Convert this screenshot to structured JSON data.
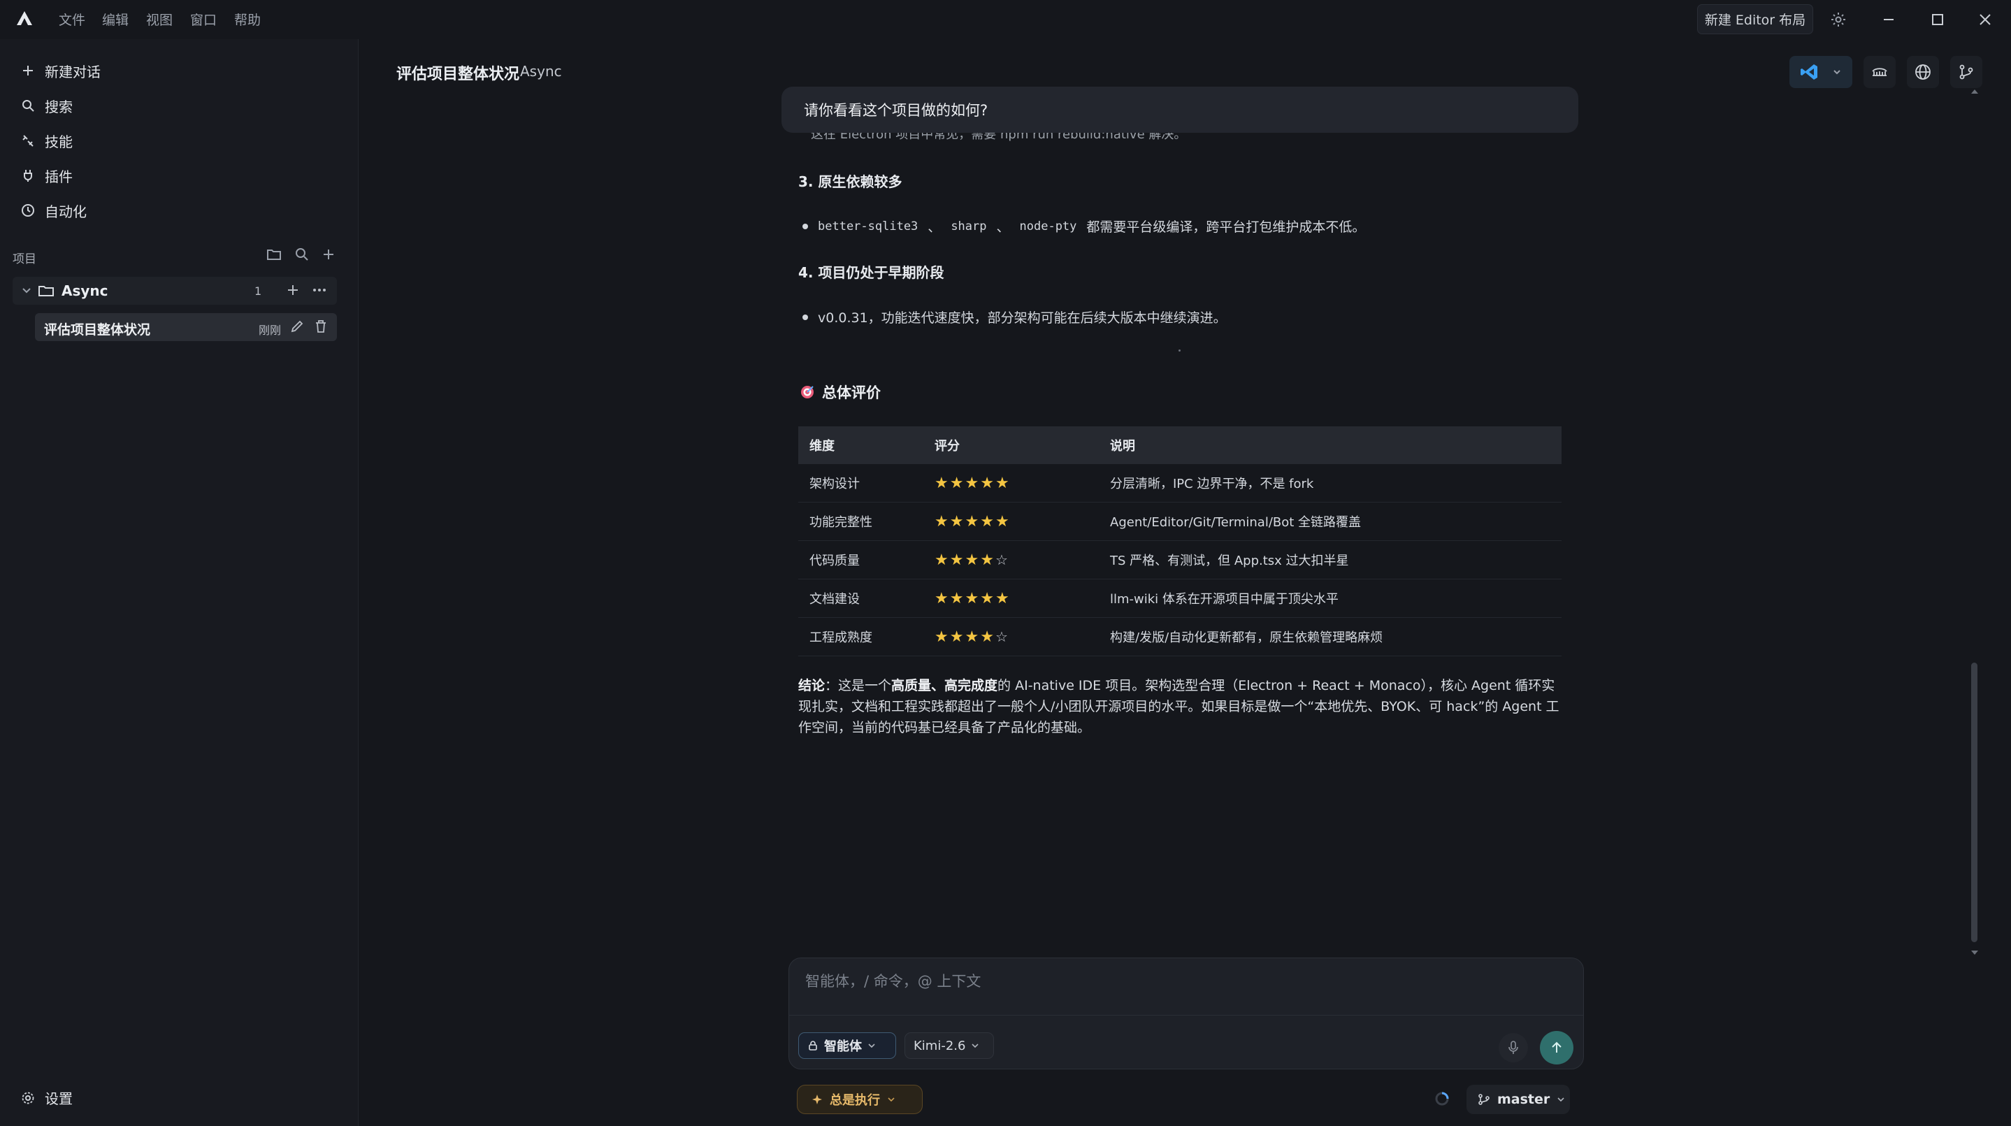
{
  "menu": [
    "文件",
    "编辑",
    "视图",
    "窗口",
    "帮助"
  ],
  "topbar": {
    "layout_button": "新建 Editor 布局"
  },
  "sidebar": {
    "nav": [
      {
        "label": "新建对话",
        "icon": "plus-icon"
      },
      {
        "label": "搜索",
        "icon": "search-icon"
      },
      {
        "label": "技能",
        "icon": "skills-icon"
      },
      {
        "label": "插件",
        "icon": "plugin-icon"
      },
      {
        "label": "自动化",
        "icon": "clock-icon"
      }
    ],
    "section_label": "项目",
    "project": {
      "name": "Async",
      "count": "1"
    },
    "chat": {
      "title": "评估项目整体状况",
      "time": "刚刚"
    },
    "settings_label": "设置"
  },
  "header": {
    "title": "评估项目整体状况",
    "subtitle": "Async"
  },
  "user_message": "请你看看这个项目做的如何?",
  "content": {
    "cutoff_text": "这在 Electron 项目中常见，需要 npm run rebuild:native 解决。",
    "h3": "3. 原生依赖较多",
    "bullet3": {
      "code1": "better-sqlite3",
      "sep1": "、",
      "code2": "sharp",
      "sep2": "、",
      "code3": "node-pty",
      "text": "都需要平台级编译，跨平台打包维护成本不低。"
    },
    "h4": "4. 项目仍处于早期阶段",
    "bullet4": "v0.0.31，功能迭代速度快，部分架构可能在后续大版本中继续演进。",
    "eval_title": "总体评价",
    "table": {
      "headers": [
        "维度",
        "评分",
        "说明"
      ],
      "rows": [
        {
          "dimension": "架构设计",
          "stars": 5,
          "note": "分层清晰，IPC 边界干净，不是 fork"
        },
        {
          "dimension": "功能完整性",
          "stars": 5,
          "note": "Agent/Editor/Git/Terminal/Bot 全链路覆盖"
        },
        {
          "dimension": "代码质量",
          "stars": 4,
          "note": "TS 严格、有测试，但 App.tsx 过大扣半星"
        },
        {
          "dimension": "文档建设",
          "stars": 5,
          "note": "llm-wiki 体系在开源项目中属于顶尖水平"
        },
        {
          "dimension": "工程成熟度",
          "stars": 4,
          "note": "构建/发版/自动化更新都有，原生依赖管理略麻烦"
        }
      ]
    },
    "conclusion": {
      "label": "结论",
      "p1": "：这是一个",
      "bold1": "高质量、高完成度",
      "p2": "的 AI-native IDE 项目。架构选型合理（Electron + React + Monaco），核心 Agent 循环实现扎实，文档和工程实践都超出了一般个人/小团队开源项目的水平。如果目标是做一个“本地优先、BYOK、可 hack”的 Agent 工作空间，当前的代码基已经具备了产品化的基础。"
    }
  },
  "composer": {
    "placeholder": "智能体，/ 命令，@ 上下文",
    "agent_label": "智能体",
    "model_label": "Kimi-2.6"
  },
  "footer": {
    "exec_label": "总是执行",
    "branch": "master"
  },
  "colors": {
    "accent_teal": "#2f6f6c",
    "star": "#f4c542",
    "vscode_blue": "#3aa0f3",
    "exec_amber": "#e6b96a"
  }
}
